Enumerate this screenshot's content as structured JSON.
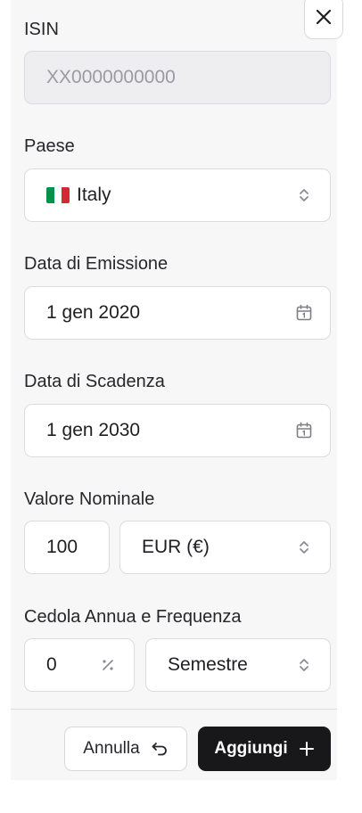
{
  "form": {
    "isin": {
      "label": "ISIN",
      "placeholder": "XX0000000000"
    },
    "country": {
      "label": "Paese",
      "value": "Italy",
      "flag_colors": [
        "#009246",
        "#ffffff",
        "#ce2b37"
      ],
      "icon": "chevron-updown-icon"
    },
    "issue_date": {
      "label": "Data di Emissione",
      "value": "1 gen 2020",
      "icon": "calendar-icon"
    },
    "maturity_date": {
      "label": "Data di Scadenza",
      "value": "1 gen 2030",
      "icon": "calendar-icon"
    },
    "nominal_value": {
      "label": "Valore Nominale",
      "amount": "100",
      "currency": "EUR (€)"
    },
    "coupon": {
      "label": "Cedola Annua e Frequenza",
      "rate": "0",
      "rate_icon": "percent-icon",
      "frequency": "Semestre"
    }
  },
  "actions": {
    "cancel_label": "Annulla",
    "add_label": "Aggiungi",
    "primary_color": "#18181b"
  }
}
